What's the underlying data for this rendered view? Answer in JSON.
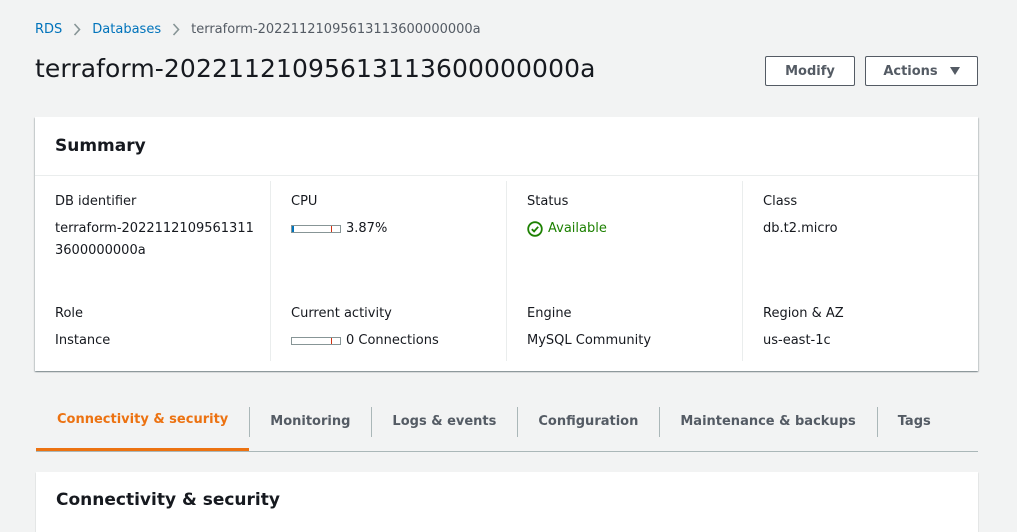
{
  "breadcrumb": {
    "items": [
      "RDS",
      "Databases"
    ],
    "current": "terraform-20221121095613113600000000a"
  },
  "page": {
    "title": "terraform-20221121095613113600000000a"
  },
  "toolbar": {
    "modify_label": "Modify",
    "actions_label": "Actions"
  },
  "summary": {
    "title": "Summary",
    "db_identifier": {
      "label": "DB identifier",
      "value": "terraform-20221121095613113600000000a"
    },
    "role": {
      "label": "Role",
      "value": "Instance"
    },
    "cpu": {
      "label": "CPU",
      "value": "3.87%",
      "level_percent": 3.87
    },
    "current_activity": {
      "label": "Current activity",
      "value": "0 Connections",
      "level_percent": 0
    },
    "status": {
      "label": "Status",
      "value": "Available",
      "color": "#1d8102"
    },
    "engine": {
      "label": "Engine",
      "value": "MySQL Community"
    },
    "class": {
      "label": "Class",
      "value": "db.t2.micro"
    },
    "region_az": {
      "label": "Region & AZ",
      "value": "us-east-1c"
    }
  },
  "tabs": [
    {
      "label": "Connectivity & security",
      "active": true
    },
    {
      "label": "Monitoring",
      "active": false
    },
    {
      "label": "Logs & events",
      "active": false
    },
    {
      "label": "Configuration",
      "active": false
    },
    {
      "label": "Maintenance & backups",
      "active": false
    },
    {
      "label": "Tags",
      "active": false
    }
  ],
  "section": {
    "title": "Connectivity & security"
  },
  "colors": {
    "link": "#0073bb",
    "accent": "#ec7211",
    "success": "#1d8102"
  }
}
